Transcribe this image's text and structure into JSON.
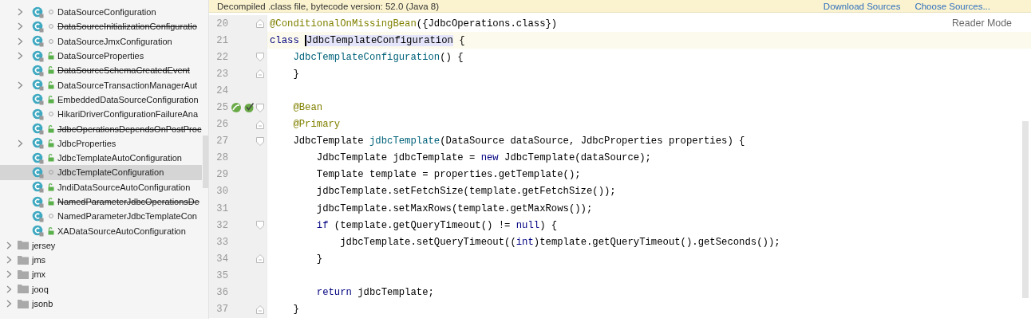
{
  "project_tree": {
    "package_contents": [
      {
        "label": "DataSourceConfiguration",
        "expandable": true,
        "deprecated": false,
        "public": false,
        "selected": false
      },
      {
        "label": "DataSourceInitializationConfiguratio",
        "expandable": true,
        "deprecated": true,
        "public": false,
        "selected": false
      },
      {
        "label": "DataSourceJmxConfiguration",
        "expandable": true,
        "deprecated": false,
        "public": false,
        "selected": false
      },
      {
        "label": "DataSourceProperties",
        "expandable": true,
        "deprecated": false,
        "public": true,
        "selected": false
      },
      {
        "label": "DataSourceSchemaCreatedEvent",
        "expandable": false,
        "deprecated": true,
        "public": true,
        "selected": false
      },
      {
        "label": "DataSourceTransactionManagerAut",
        "expandable": true,
        "deprecated": false,
        "public": true,
        "selected": false
      },
      {
        "label": "EmbeddedDataSourceConfiguration",
        "expandable": false,
        "deprecated": false,
        "public": true,
        "selected": false
      },
      {
        "label": "HikariDriverConfigurationFailureAna",
        "expandable": false,
        "deprecated": false,
        "public": false,
        "selected": false
      },
      {
        "label": "JdbcOperationsDependsOnPostProc",
        "expandable": false,
        "deprecated": true,
        "public": true,
        "selected": false
      },
      {
        "label": "JdbcProperties",
        "expandable": true,
        "deprecated": false,
        "public": true,
        "selected": false
      },
      {
        "label": "JdbcTemplateAutoConfiguration",
        "expandable": false,
        "deprecated": false,
        "public": true,
        "selected": false
      },
      {
        "label": "JdbcTemplateConfiguration",
        "expandable": false,
        "deprecated": false,
        "public": false,
        "selected": true
      },
      {
        "label": "JndiDataSourceAutoConfiguration",
        "expandable": false,
        "deprecated": false,
        "public": true,
        "selected": false
      },
      {
        "label": "NamedParameterJdbcOperationsDe",
        "expandable": false,
        "deprecated": true,
        "public": true,
        "selected": false
      },
      {
        "label": "NamedParameterJdbcTemplateCon",
        "expandable": false,
        "deprecated": false,
        "public": false,
        "selected": false
      },
      {
        "label": "XADataSourceAutoConfiguration",
        "expandable": false,
        "deprecated": false,
        "public": true,
        "selected": false
      }
    ],
    "packages": [
      {
        "label": "jersey",
        "expandable": true,
        "selected": false
      },
      {
        "label": "jms",
        "expandable": true,
        "selected": false
      },
      {
        "label": "jmx",
        "expandable": true,
        "selected": false
      },
      {
        "label": "jooq",
        "expandable": true,
        "selected": false
      },
      {
        "label": "jsonb",
        "expandable": true,
        "selected": false
      }
    ]
  },
  "editor": {
    "banner": {
      "message": "Decompiled .class file, bytecode version: 52.0 (Java 8)",
      "links": [
        "Download Sources",
        "Choose Sources..."
      ]
    },
    "reader_mode_button": "Reader Mode",
    "lines": [
      {
        "number": "20",
        "fold_end": true,
        "current": false,
        "tokens": [
          {
            "kind": "annotation",
            "text": "@ConditionalOnMissingBean"
          },
          {
            "kind": "plain",
            "text": "({JdbcOperations.class})"
          }
        ]
      },
      {
        "number": "21",
        "current": true,
        "tokens": [
          {
            "kind": "keyword",
            "text": "class "
          },
          {
            "kind": "highlight",
            "text": "JdbcTemplateConfiguration",
            "caret": true
          },
          {
            "kind": "plain",
            "text": " {"
          }
        ]
      },
      {
        "number": "22",
        "fold_start": true,
        "current": false,
        "tokens": [
          {
            "kind": "method",
            "text": "    JdbcTemplateConfiguration"
          },
          {
            "kind": "plain",
            "text": "() {"
          }
        ]
      },
      {
        "number": "23",
        "fold_end": true,
        "current": false,
        "tokens": [
          {
            "kind": "plain",
            "text": "    }"
          }
        ]
      },
      {
        "number": "24",
        "current": false
      },
      {
        "number": "25",
        "fold_start": true,
        "current": false,
        "gutter_marks": [
          {
            "kind": "bean"
          },
          {
            "kind": "bean-check"
          }
        ],
        "tokens": [
          {
            "kind": "annotation",
            "text": "    @Bean"
          }
        ]
      },
      {
        "number": "26",
        "fold_end": true,
        "current": false,
        "tokens": [
          {
            "kind": "annotation",
            "text": "    @Primary"
          }
        ]
      },
      {
        "number": "27",
        "fold_start": true,
        "current": false,
        "tokens": [
          {
            "kind": "plain",
            "text": "    JdbcTemplate "
          },
          {
            "kind": "method",
            "text": "jdbcTemplate"
          },
          {
            "kind": "plain",
            "text": "(DataSource dataSource, JdbcProperties properties) {"
          }
        ]
      },
      {
        "number": "28",
        "current": false,
        "tokens": [
          {
            "kind": "plain",
            "text": "        JdbcTemplate jdbcTemplate = "
          },
          {
            "kind": "keyword",
            "text": "new"
          },
          {
            "kind": "plain",
            "text": " JdbcTemplate(dataSource);"
          }
        ]
      },
      {
        "number": "29",
        "current": false,
        "tokens": [
          {
            "kind": "plain",
            "text": "        Template template = properties.getTemplate();"
          }
        ]
      },
      {
        "number": "30",
        "current": false,
        "tokens": [
          {
            "kind": "plain",
            "text": "        jdbcTemplate.setFetchSize(template.getFetchSize());"
          }
        ]
      },
      {
        "number": "31",
        "current": false,
        "tokens": [
          {
            "kind": "plain",
            "text": "        jdbcTemplate.setMaxRows(template.getMaxRows());"
          }
        ]
      },
      {
        "number": "32",
        "fold_start": true,
        "current": false,
        "tokens": [
          {
            "kind": "keyword",
            "text": "        if"
          },
          {
            "kind": "plain",
            "text": " (template.getQueryTimeout() != "
          },
          {
            "kind": "keyword",
            "text": "null"
          },
          {
            "kind": "plain",
            "text": ") {"
          }
        ]
      },
      {
        "number": "33",
        "current": false,
        "tokens": [
          {
            "kind": "plain",
            "text": "            jdbcTemplate.setQueryTimeout(("
          },
          {
            "kind": "keyword",
            "text": "int"
          },
          {
            "kind": "plain",
            "text": ")template.getQueryTimeout().getSeconds());"
          }
        ]
      },
      {
        "number": "34",
        "fold_end": true,
        "current": false,
        "tokens": [
          {
            "kind": "plain",
            "text": "        }"
          }
        ]
      },
      {
        "number": "35",
        "current": false
      },
      {
        "number": "36",
        "current": false,
        "tokens": [
          {
            "kind": "keyword",
            "text": "        return"
          },
          {
            "kind": "plain",
            "text": " jdbcTemplate;"
          }
        ]
      },
      {
        "number": "37",
        "fold_end": true,
        "current": false,
        "tokens": [
          {
            "kind": "plain",
            "text": "    }"
          }
        ]
      }
    ]
  }
}
